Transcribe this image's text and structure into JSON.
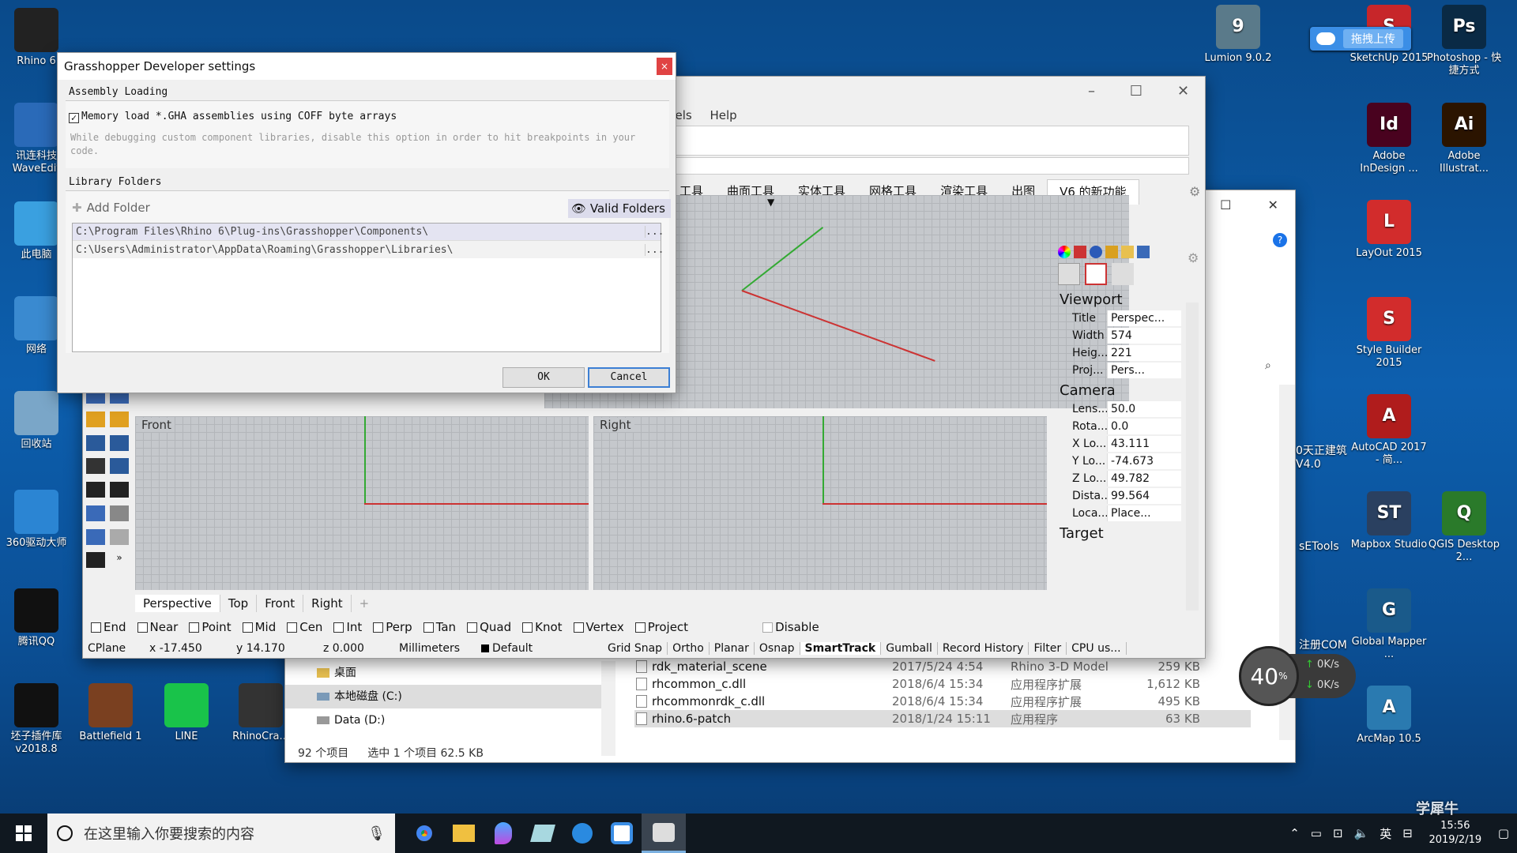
{
  "desktop_left": [
    {
      "label": "Rhino 6",
      "color": "#222"
    },
    {
      "label": "讯连科技 WaveEdit",
      "color": "#2a6ab8"
    },
    {
      "label": "此电脑",
      "color": "#3aa0e0"
    },
    {
      "label": "网络",
      "color": "#3a8ad0"
    },
    {
      "label": "回收站",
      "color": "#7aa6c8"
    },
    {
      "label": "360驱动大师",
      "color": "#2b85d3"
    },
    {
      "label": "腾讯QQ",
      "color": "#111"
    },
    {
      "label": "坯子插件库 v2018.8",
      "color": "#111"
    }
  ],
  "desktop_bottom": [
    {
      "label": "Battlefield 1",
      "color": "#7a4020"
    },
    {
      "label": "LINE",
      "color": "#19c34a"
    },
    {
      "label": "RhinoCra...",
      "color": "#333"
    }
  ],
  "desktop_right": [
    {
      "label": "Lumion 9.0.2",
      "color": "#5a7a8a",
      "glyph": "9"
    },
    {
      "label": "SketchUp 2015",
      "color": "#c7262a",
      "glyph": "S"
    },
    {
      "label": "Photoshop - 快捷方式",
      "color": "#0a2a45",
      "glyph": "Ps"
    },
    {
      "label": "Adobe InDesign ...",
      "color": "#49021f",
      "glyph": "Id"
    },
    {
      "label": "Adobe Illustrat...",
      "color": "#2b1400",
      "glyph": "Ai"
    },
    {
      "label": "LayOut 2015",
      "color": "#d22c2c",
      "glyph": "L"
    },
    {
      "label": "Style Builder 2015",
      "color": "#d22c2c",
      "glyph": "S"
    },
    {
      "label": "AutoCAD 2017 - 简...",
      "color": "#b01c1c",
      "glyph": "A"
    },
    {
      "label": "Mapbox Studio",
      "color": "#2a4060",
      "glyph": "ST"
    },
    {
      "label": "QGIS Desktop 2...",
      "color": "#2a7a2a",
      "glyph": "Q"
    },
    {
      "label": "Global Mapper ...",
      "color": "#1a5a8a",
      "glyph": "G"
    },
    {
      "label": "ArcMap 10.5",
      "color": "#2a7ab0",
      "glyph": "A"
    }
  ],
  "upload_badge": "拖拽上传",
  "partial_icons": [
    "0天正建筑 V4.0",
    "sETools",
    "注册COM"
  ],
  "dialog": {
    "title": "Grasshopper Developer settings",
    "close": "×",
    "assembly_header": "Assembly Loading",
    "checkbox_label": "Memory load *.GHA assemblies using COFF byte arrays",
    "hint": "While debugging custom component libraries, disable this option in order to hit breakpoints in your code.",
    "library_header": "Library Folders",
    "add_folder": "Add Folder",
    "valid_folders": "Valid Folders",
    "folders": [
      "C:\\Program Files\\Rhino 6\\Plug-ins\\Grasshopper\\Components\\",
      "C:\\Users\\Administrator\\AppData\\Roaming\\Grasshopper\\Libraries\\"
    ],
    "folder_btn": "...",
    "ok": "OK",
    "cancel": "Cancel"
  },
  "rhino": {
    "menu_partial": "nels",
    "menu_help": "Help",
    "tabs": [
      "工具",
      "曲面工具",
      "实体工具",
      "网格工具",
      "渲染工具",
      "出图",
      "V6 的新功能"
    ],
    "views": {
      "front": "Front",
      "right": "Right"
    },
    "view_tabs": [
      "Perspective",
      "Top",
      "Front",
      "Right"
    ],
    "add_tab": "+",
    "osnaps": [
      "End",
      "Near",
      "Point",
      "Mid",
      "Cen",
      "Int",
      "Perp",
      "Tan",
      "Quad",
      "Knot",
      "Vertex",
      "Project",
      "Disable"
    ],
    "status": {
      "cplane": "CPlane",
      "x": "x -17.450",
      "y": "y 14.170",
      "z": "z 0.000",
      "units": "Millimeters",
      "layer": "Default"
    },
    "status_toggles": [
      "Grid Snap",
      "Ortho",
      "Planar",
      "Osnap",
      "SmartTrack",
      "Gumball",
      "Record History",
      "Filter",
      "CPU us..."
    ],
    "panel": {
      "viewport_header": "Viewport",
      "viewport_rows": [
        [
          "Title",
          "Perspec..."
        ],
        [
          "Width",
          "574"
        ],
        [
          "Heig...",
          "221"
        ],
        [
          "Proj...",
          "Pers..."
        ]
      ],
      "camera_header": "Camera",
      "camera_rows": [
        [
          "Lens...",
          "50.0"
        ],
        [
          "Rota...",
          "0.0"
        ],
        [
          "X Lo...",
          "43.111"
        ],
        [
          "Y Lo...",
          "-74.673"
        ],
        [
          "Z Lo...",
          "49.782"
        ],
        [
          "Dista...",
          "99.564"
        ],
        [
          "Loca...",
          "Place..."
        ]
      ],
      "target_header": "Target"
    }
  },
  "explorer": {
    "nav": [
      {
        "label": "桌面"
      },
      {
        "label": "本地磁盘 (C:)"
      },
      {
        "label": "Data (D:)"
      }
    ],
    "files": [
      {
        "name": "rdk_material_scene",
        "date": "2017/5/24 4:54",
        "type": "Rhino 3-D Model",
        "size": "259 KB"
      },
      {
        "name": "rhcommon_c.dll",
        "date": "2018/6/4 15:34",
        "type": "应用程序扩展",
        "size": "1,612 KB"
      },
      {
        "name": "rhcommonrdk_c.dll",
        "date": "2018/6/4 15:34",
        "type": "应用程序扩展",
        "size": "495 KB"
      },
      {
        "name": "rhino.6-patch",
        "date": "2018/1/24 15:11",
        "type": "应用程序",
        "size": "63 KB"
      }
    ],
    "status_count": "92 个项目",
    "status_selected": "选中 1 个项目  62.5 KB"
  },
  "speed": {
    "percent": "40",
    "unit": "%",
    "up": "0K/s",
    "down": "0K/s"
  },
  "taskbar": {
    "search_placeholder": "在这里输入你要搜索的内容",
    "ime": "英",
    "time": "15:56",
    "date": "2019/2/19"
  },
  "watermark": "学犀牛"
}
